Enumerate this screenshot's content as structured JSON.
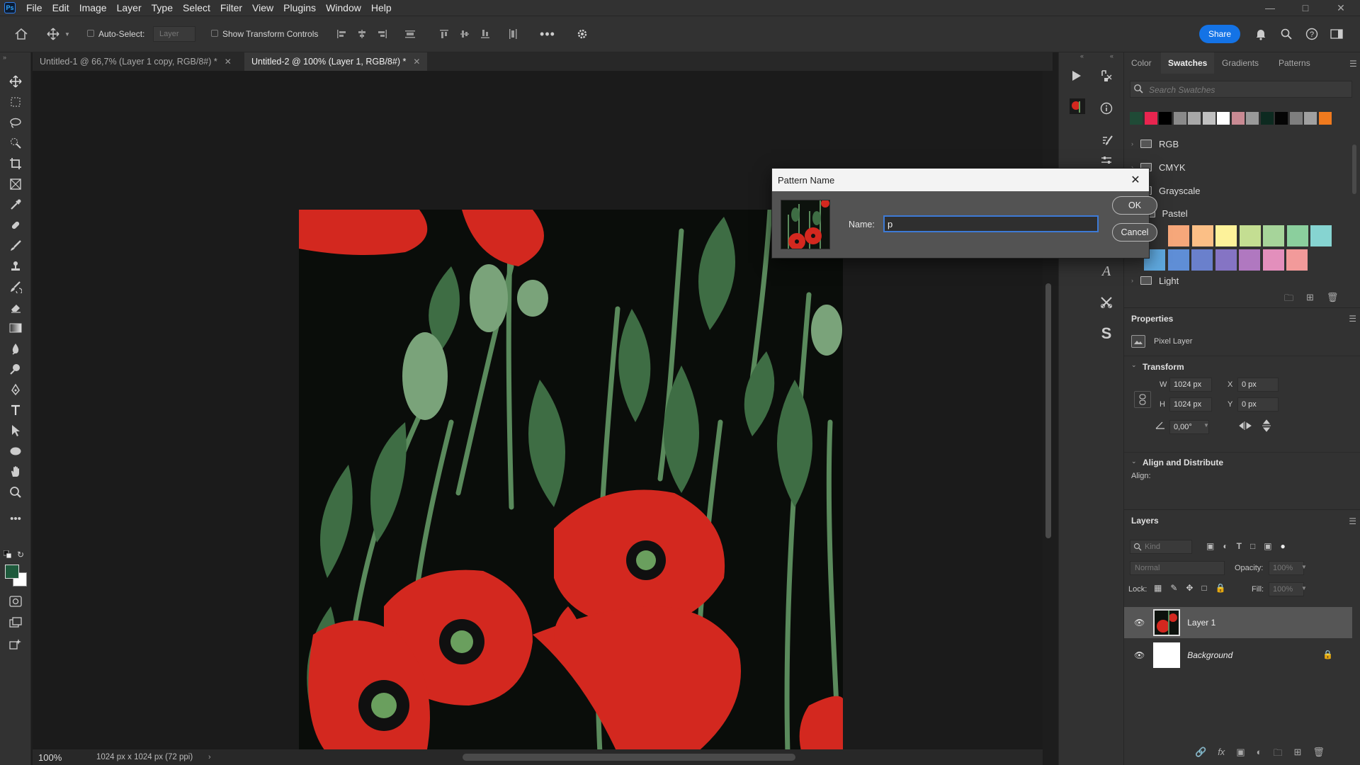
{
  "app": {
    "logo": "Ps"
  },
  "menu": [
    "File",
    "Edit",
    "Image",
    "Layer",
    "Type",
    "Select",
    "Filter",
    "View",
    "Plugins",
    "Window",
    "Help"
  ],
  "options": {
    "auto_select_label": "Auto-Select:",
    "layer_select_value": "Layer",
    "show_transform_label": "Show Transform Controls",
    "share_label": "Share"
  },
  "tabs": [
    {
      "label": "Untitled-1 @ 66,7% (Layer 1 copy, RGB/8#) *",
      "active": false
    },
    {
      "label": "Untitled-2 @ 100% (Layer 1, RGB/8#) *",
      "active": true
    }
  ],
  "status": {
    "zoom": "100%",
    "doc_info": "1024 px x 1024 px (72 ppi)"
  },
  "swatches_panel": {
    "tabs": [
      "Color",
      "Swatches",
      "Gradients",
      "Patterns"
    ],
    "active_tab": "Swatches",
    "search_placeholder": "Search Swatches",
    "recent_colors": [
      "#1f4a36",
      "#e8254f",
      "#000000",
      "#8a8a8a",
      "#a8a8a8",
      "#c0c0c0",
      "#ffffff",
      "#c98a93",
      "#9a9a9a",
      "#0d2a20",
      "#050505",
      "#7e7e7e",
      "#a0a0a0",
      "#f07a1e"
    ],
    "folders": [
      "RGB",
      "CMYK",
      "Grayscale",
      "Pastel",
      "Light"
    ],
    "pastel_row1": [
      "#f6a77a",
      "#fbbf86",
      "#fdf29a",
      "#c4de92",
      "#a6d49a",
      "#8bcf9d",
      "#86d4d1"
    ],
    "pastel_row2": [
      "#5ea7dd",
      "#5f8ed6",
      "#6a80cc",
      "#8574c4",
      "#b078c0",
      "#e38fbc",
      "#f29a9a"
    ]
  },
  "properties": {
    "title": "Properties",
    "layer_kind": "Pixel Layer",
    "transform_title": "Transform",
    "w_label": "W",
    "w_value": "1024 px",
    "h_label": "H",
    "h_value": "1024 px",
    "x_label": "X",
    "x_value": "0 px",
    "y_label": "Y",
    "y_value": "0 px",
    "angle_value": "0,00°",
    "align_title": "Align and Distribute",
    "align_label": "Align:"
  },
  "layers": {
    "title": "Layers",
    "kind_placeholder": "Kind",
    "blend_mode": "Normal",
    "opacity_label": "Opacity:",
    "opacity_value": "100%",
    "lock_label": "Lock:",
    "fill_label": "Fill:",
    "fill_value": "100%",
    "items": [
      {
        "name": "Layer 1",
        "selected": true
      },
      {
        "name": "Background",
        "selected": false,
        "locked": true
      }
    ]
  },
  "dialog": {
    "title": "Pattern Name",
    "name_label": "Name:",
    "name_value": "p",
    "ok_label": "OK",
    "cancel_label": "Cancel"
  },
  "colors": {
    "accent": "#1473e6",
    "foreground": "#1e5a3c",
    "background": "#ffffff"
  }
}
